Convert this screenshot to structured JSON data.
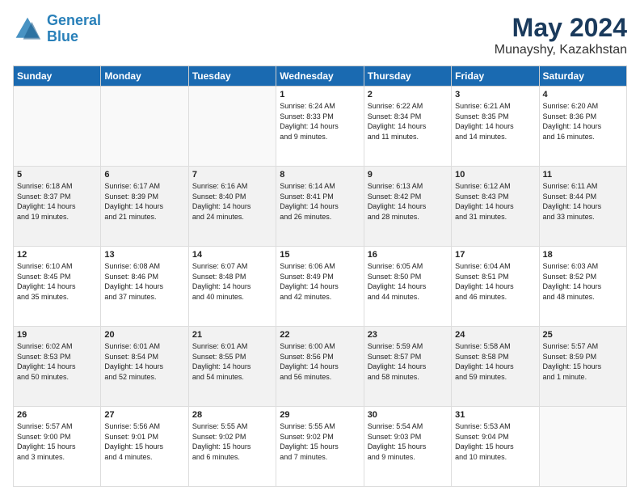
{
  "header": {
    "logo_line1": "General",
    "logo_line2": "Blue",
    "title": "May 2024",
    "subtitle": "Munayshy, Kazakhstan"
  },
  "days_of_week": [
    "Sunday",
    "Monday",
    "Tuesday",
    "Wednesday",
    "Thursday",
    "Friday",
    "Saturday"
  ],
  "weeks": [
    [
      {
        "num": "",
        "info": ""
      },
      {
        "num": "",
        "info": ""
      },
      {
        "num": "",
        "info": ""
      },
      {
        "num": "1",
        "info": "Sunrise: 6:24 AM\nSunset: 8:33 PM\nDaylight: 14 hours\nand 9 minutes."
      },
      {
        "num": "2",
        "info": "Sunrise: 6:22 AM\nSunset: 8:34 PM\nDaylight: 14 hours\nand 11 minutes."
      },
      {
        "num": "3",
        "info": "Sunrise: 6:21 AM\nSunset: 8:35 PM\nDaylight: 14 hours\nand 14 minutes."
      },
      {
        "num": "4",
        "info": "Sunrise: 6:20 AM\nSunset: 8:36 PM\nDaylight: 14 hours\nand 16 minutes."
      }
    ],
    [
      {
        "num": "5",
        "info": "Sunrise: 6:18 AM\nSunset: 8:37 PM\nDaylight: 14 hours\nand 19 minutes."
      },
      {
        "num": "6",
        "info": "Sunrise: 6:17 AM\nSunset: 8:39 PM\nDaylight: 14 hours\nand 21 minutes."
      },
      {
        "num": "7",
        "info": "Sunrise: 6:16 AM\nSunset: 8:40 PM\nDaylight: 14 hours\nand 24 minutes."
      },
      {
        "num": "8",
        "info": "Sunrise: 6:14 AM\nSunset: 8:41 PM\nDaylight: 14 hours\nand 26 minutes."
      },
      {
        "num": "9",
        "info": "Sunrise: 6:13 AM\nSunset: 8:42 PM\nDaylight: 14 hours\nand 28 minutes."
      },
      {
        "num": "10",
        "info": "Sunrise: 6:12 AM\nSunset: 8:43 PM\nDaylight: 14 hours\nand 31 minutes."
      },
      {
        "num": "11",
        "info": "Sunrise: 6:11 AM\nSunset: 8:44 PM\nDaylight: 14 hours\nand 33 minutes."
      }
    ],
    [
      {
        "num": "12",
        "info": "Sunrise: 6:10 AM\nSunset: 8:45 PM\nDaylight: 14 hours\nand 35 minutes."
      },
      {
        "num": "13",
        "info": "Sunrise: 6:08 AM\nSunset: 8:46 PM\nDaylight: 14 hours\nand 37 minutes."
      },
      {
        "num": "14",
        "info": "Sunrise: 6:07 AM\nSunset: 8:48 PM\nDaylight: 14 hours\nand 40 minutes."
      },
      {
        "num": "15",
        "info": "Sunrise: 6:06 AM\nSunset: 8:49 PM\nDaylight: 14 hours\nand 42 minutes."
      },
      {
        "num": "16",
        "info": "Sunrise: 6:05 AM\nSunset: 8:50 PM\nDaylight: 14 hours\nand 44 minutes."
      },
      {
        "num": "17",
        "info": "Sunrise: 6:04 AM\nSunset: 8:51 PM\nDaylight: 14 hours\nand 46 minutes."
      },
      {
        "num": "18",
        "info": "Sunrise: 6:03 AM\nSunset: 8:52 PM\nDaylight: 14 hours\nand 48 minutes."
      }
    ],
    [
      {
        "num": "19",
        "info": "Sunrise: 6:02 AM\nSunset: 8:53 PM\nDaylight: 14 hours\nand 50 minutes."
      },
      {
        "num": "20",
        "info": "Sunrise: 6:01 AM\nSunset: 8:54 PM\nDaylight: 14 hours\nand 52 minutes."
      },
      {
        "num": "21",
        "info": "Sunrise: 6:01 AM\nSunset: 8:55 PM\nDaylight: 14 hours\nand 54 minutes."
      },
      {
        "num": "22",
        "info": "Sunrise: 6:00 AM\nSunset: 8:56 PM\nDaylight: 14 hours\nand 56 minutes."
      },
      {
        "num": "23",
        "info": "Sunrise: 5:59 AM\nSunset: 8:57 PM\nDaylight: 14 hours\nand 58 minutes."
      },
      {
        "num": "24",
        "info": "Sunrise: 5:58 AM\nSunset: 8:58 PM\nDaylight: 14 hours\nand 59 minutes."
      },
      {
        "num": "25",
        "info": "Sunrise: 5:57 AM\nSunset: 8:59 PM\nDaylight: 15 hours\nand 1 minute."
      }
    ],
    [
      {
        "num": "26",
        "info": "Sunrise: 5:57 AM\nSunset: 9:00 PM\nDaylight: 15 hours\nand 3 minutes."
      },
      {
        "num": "27",
        "info": "Sunrise: 5:56 AM\nSunset: 9:01 PM\nDaylight: 15 hours\nand 4 minutes."
      },
      {
        "num": "28",
        "info": "Sunrise: 5:55 AM\nSunset: 9:02 PM\nDaylight: 15 hours\nand 6 minutes."
      },
      {
        "num": "29",
        "info": "Sunrise: 5:55 AM\nSunset: 9:02 PM\nDaylight: 15 hours\nand 7 minutes."
      },
      {
        "num": "30",
        "info": "Sunrise: 5:54 AM\nSunset: 9:03 PM\nDaylight: 15 hours\nand 9 minutes."
      },
      {
        "num": "31",
        "info": "Sunrise: 5:53 AM\nSunset: 9:04 PM\nDaylight: 15 hours\nand 10 minutes."
      },
      {
        "num": "",
        "info": ""
      }
    ]
  ]
}
